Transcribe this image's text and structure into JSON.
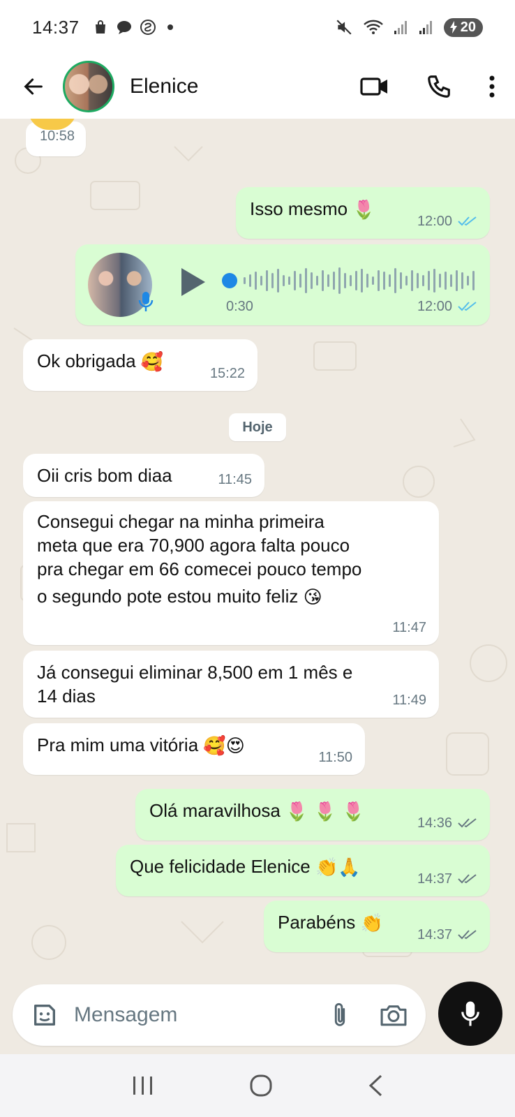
{
  "status_bar": {
    "time": "14:37",
    "battery": "20",
    "icons": [
      "shopping-bag-icon",
      "chat-icon",
      "app-icon",
      "dot-icon",
      "mute-icon",
      "wifi-icon",
      "signal-icon",
      "signal-icon",
      "battery-icon"
    ]
  },
  "header": {
    "contact_name": "Elenice",
    "icons": [
      "back-arrow-icon",
      "video-call-icon",
      "phone-icon",
      "more-icon"
    ]
  },
  "messages": [
    {
      "id": "m0",
      "dir": "in",
      "text": "",
      "time": "10:58"
    },
    {
      "id": "m1",
      "dir": "out",
      "text": "Isso mesmo",
      "emoji": "🌷",
      "time": "12:00",
      "ticks": "read"
    },
    {
      "id": "m2",
      "dir": "out",
      "type": "voice",
      "duration": "0:30",
      "time": "12:00",
      "ticks": "read"
    },
    {
      "id": "m3",
      "dir": "in",
      "text": "Ok obrigada",
      "emoji": "🥰",
      "time": "15:22"
    },
    {
      "id": "m4",
      "dir": "in",
      "text": "Oii cris bom diaa",
      "time": "11:45"
    },
    {
      "id": "m5",
      "dir": "in",
      "lines": [
        "Consegui chegar na minha primeira",
        "meta que era 70,900 agora falta pouco",
        "pra chegar em 66 comecei pouco tempo",
        "o segundo pote estou muito feliz"
      ],
      "emoji": "😘",
      "time": "11:47"
    },
    {
      "id": "m6",
      "dir": "in",
      "lines": [
        "Já  consegui eliminar 8,500 em 1 mês e",
        "14 dias"
      ],
      "time": "11:49"
    },
    {
      "id": "m7",
      "dir": "in",
      "text": "Pra mim uma vitória",
      "emoji": "🥰😍",
      "time": "11:50"
    },
    {
      "id": "m8",
      "dir": "out",
      "text": "Olá maravilhosa",
      "emoji": "🌷 🌷 🌷",
      "time": "14:36",
      "ticks": "delivered"
    },
    {
      "id": "m9",
      "dir": "out",
      "text": "Que felicidade Elenice",
      "emoji": "👏🙏",
      "time": "14:37",
      "ticks": "delivered"
    },
    {
      "id": "m10",
      "dir": "out",
      "text": "Parabéns",
      "emoji": "👏",
      "time": "14:37",
      "ticks": "delivered"
    }
  ],
  "date_chip": "Hoje",
  "composer": {
    "placeholder": "Mensagem",
    "icons": [
      "sticker-icon",
      "attach-icon",
      "camera-icon",
      "mic-icon"
    ]
  },
  "colors": {
    "incoming": "#ffffff",
    "outgoing": "#d9fdd3",
    "background": "#efeae2",
    "read_tick": "#53bdeb",
    "accent": "#1daa61"
  },
  "nav_bar": {
    "icons": [
      "recent-apps-icon",
      "home-icon",
      "back-nav-icon"
    ]
  }
}
